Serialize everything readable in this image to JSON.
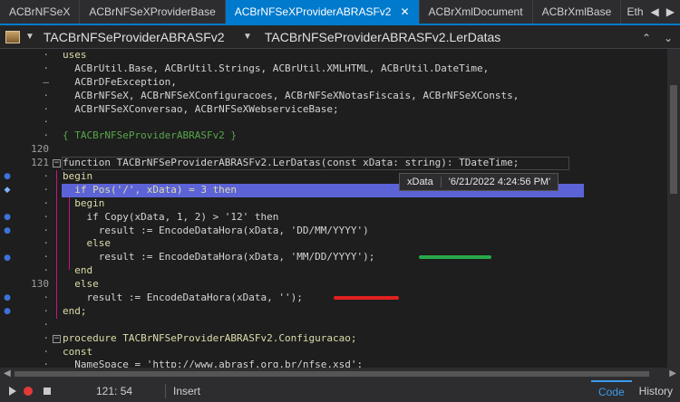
{
  "tabs": [
    {
      "label": "ACBrNFSeX",
      "active": false
    },
    {
      "label": "ACBrNFSeXProviderBase",
      "active": false
    },
    {
      "label": "ACBrNFSeXProviderABRASFv2",
      "active": true
    },
    {
      "label": "ACBrXmlDocument",
      "active": false
    },
    {
      "label": "ACBrXmlBase",
      "active": false
    }
  ],
  "tabs_overflow": "Eth",
  "nav": {
    "unit": "TACBrNFSeProviderABRASFv2",
    "method": "TACBrNFSeProviderABRASFv2.LerDatas"
  },
  "gutter": {
    "n120": "120",
    "n121": "121",
    "n130": "130"
  },
  "code": {
    "l0": "uses",
    "l1": "  ACBrUtil.Base, ACBrUtil.Strings, ACBrUtil.XMLHTML, ACBrUtil.DateTime,",
    "l2": "  ACBrDFeException,",
    "l3": "  ACBrNFSeX, ACBrNFSeXConfiguracoes, ACBrNFSeXNotasFiscais, ACBrNFSeXConsts,",
    "l4": "  ACBrNFSeXConversao, ACBrNFSeXWebserviceBase;",
    "l6": "{ TACBrNFSeProviderABRASFv2 }",
    "l8": "function TACBrNFSeProviderABRASFv2.LerDatas(const xData: string): TDateTime;",
    "l9": "begin",
    "l10": "  if Pos('/', xData) = 3 then",
    "l11": "  begin",
    "l12": "    if Copy(xData, 1, 2) > '12' then",
    "l13": "      result := EncodeDataHora(xData, 'DD/MM/YYYY')",
    "l14": "    else",
    "l15": "      result := EncodeDataHora(xData, 'MM/DD/YYYY');",
    "l16": "  end",
    "l17": "  else",
    "l18": "    result := EncodeDataHora(xData, '');",
    "l19": "end;",
    "l21": "procedure TACBrNFSeProviderABRASFv2.Configuracao;",
    "l22": "const",
    "l23": "  NameSpace = 'http://www.abrasf.org.br/nfse.xsd';"
  },
  "tooltip": {
    "name": "xData",
    "value": "'6/21/2022 4:24:56 PM'"
  },
  "status": {
    "position": "121: 54",
    "mode": "Insert",
    "tab_code": "Code",
    "tab_history": "History"
  },
  "colors": {
    "accent": "#007acc",
    "exec_line": "#5c63d6",
    "mark_green": "#2aa84a",
    "mark_red": "#e02020"
  }
}
